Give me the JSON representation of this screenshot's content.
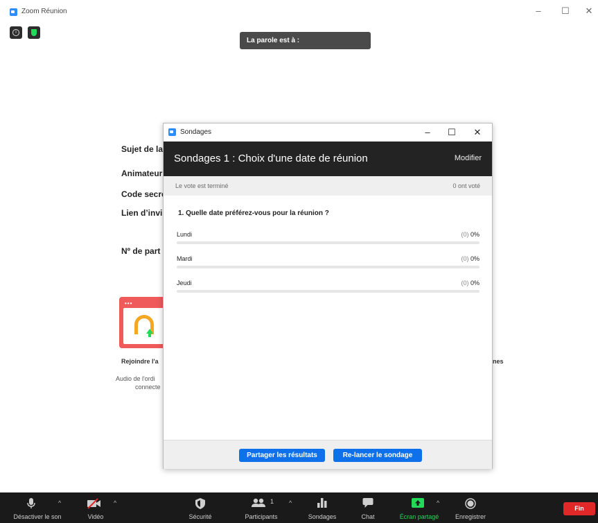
{
  "window": {
    "title": "Zoom Réunion",
    "controls": [
      "–",
      "☐",
      "✕"
    ]
  },
  "speaker_banner": {
    "text": "La parole est à :"
  },
  "meeting_info": {
    "labels": [
      "Sujet de la",
      "Animateur",
      "Code secre",
      "Lien d’invi",
      "Nº de part"
    ],
    "join_audio_label": "Rejoindre l'a",
    "audio_desc_line1": "Audio de l'ordi",
    "audio_desc_line2": "connecte",
    "right_fragment": "nes"
  },
  "poll_dialog": {
    "window_title": "Sondages",
    "controls": [
      "–",
      "☐",
      "✕"
    ],
    "header_title": "Sondages 1 : Choix d'une date de réunion",
    "edit_label": "Modifier",
    "status_left": "Le vote est terminé",
    "status_right": "0 ont voté",
    "question": "1. Quelle date préférez-vous pour la réunion ?",
    "options": [
      {
        "label": "Lundi",
        "count": "(0)",
        "percent": "0%",
        "fraction": 0
      },
      {
        "label": "Mardi",
        "count": "(0)",
        "percent": "0%",
        "fraction": 0
      },
      {
        "label": "Jeudi",
        "count": "(0)",
        "percent": "0%",
        "fraction": 0
      }
    ],
    "share_button": "Partager les résultats",
    "relaunch_button": "Re-lancer le sondage"
  },
  "toolbar": {
    "mute": "Désactiver le son",
    "video": "Vidéo",
    "security": "Sécurité",
    "participants": "Participants",
    "participants_count": "1",
    "polls": "Sondages",
    "chat": "Chat",
    "share": "Écran partagé",
    "record": "Enregistrer",
    "end": "Fin"
  },
  "colors": {
    "accent": "#0e71eb",
    "share_green": "#23d959",
    "end_red": "#e02828",
    "toolbar_bg": "#1a1a1a"
  }
}
